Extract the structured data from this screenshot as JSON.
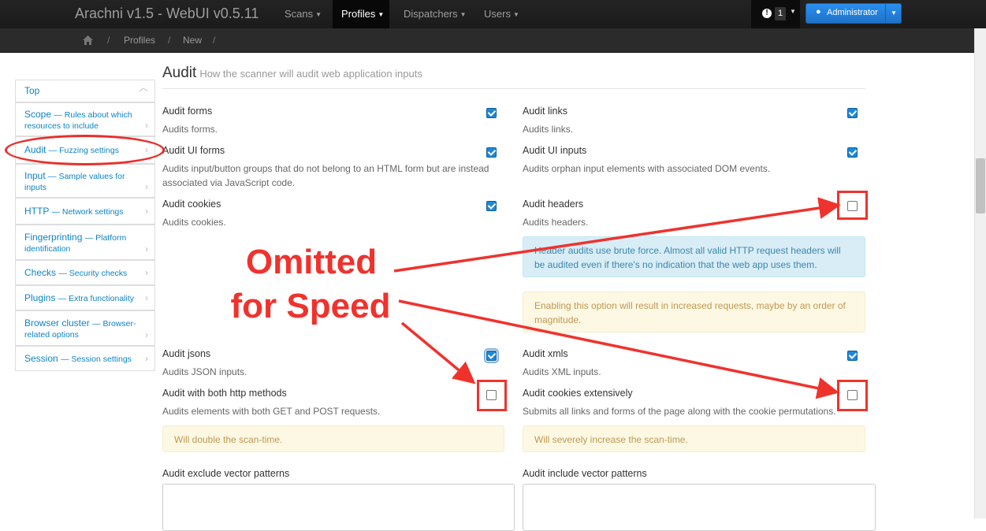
{
  "app": {
    "brand": "Arachni v1.5 - WebUI v0.5.11",
    "nav": [
      {
        "label": "Scans"
      },
      {
        "label": "Profiles"
      },
      {
        "label": "Dispatchers"
      },
      {
        "label": "Users"
      }
    ],
    "notification_count": "1",
    "user_label": "Administrator"
  },
  "breadcrumb": {
    "home_icon": "home-icon",
    "items": [
      "Profiles",
      "New"
    ],
    "separator": "/"
  },
  "sidebar": {
    "items": [
      {
        "label": "Top",
        "desc": ""
      },
      {
        "label": "Scope",
        "desc": "— Rules about which resources to include"
      },
      {
        "label": "Audit",
        "desc": "— Fuzzing settings"
      },
      {
        "label": "Input",
        "desc": "— Sample values for inputs"
      },
      {
        "label": "HTTP",
        "desc": "— Network settings"
      },
      {
        "label": "Fingerprinting",
        "desc": "— Platform identification"
      },
      {
        "label": "Checks",
        "desc": "— Security checks"
      },
      {
        "label": "Plugins",
        "desc": "— Extra functionality"
      },
      {
        "label": "Browser cluster",
        "desc": "— Browser-related options"
      },
      {
        "label": "Session",
        "desc": "— Session settings"
      }
    ]
  },
  "section": {
    "title": "Audit",
    "subtitle": "How the scanner will audit web application inputs"
  },
  "options": {
    "forms": {
      "label": "Audit forms",
      "desc": "Audits forms.",
      "checked": true
    },
    "links": {
      "label": "Audit links",
      "desc": "Audits links.",
      "checked": true
    },
    "ui_forms": {
      "label": "Audit UI forms",
      "desc": "Audits input/button groups that do not belong to an HTML form but are instead associated via JavaScript code.",
      "checked": true
    },
    "ui_inputs": {
      "label": "Audit UI inputs",
      "desc": "Audits orphan input elements with associated DOM events.",
      "checked": true
    },
    "cookies": {
      "label": "Audit cookies",
      "desc": "Audits cookies.",
      "checked": true
    },
    "headers": {
      "label": "Audit headers",
      "desc": "Audits headers.",
      "checked": false,
      "info": "Header audits use brute force. Almost all valid HTTP request headers will be audited even if there's no indication that the web app uses them.",
      "warning": "Enabling this option will result in increased requests, maybe by an order of magnitude."
    },
    "jsons": {
      "label": "Audit jsons",
      "desc": "Audits JSON inputs.",
      "checked": true
    },
    "xmls": {
      "label": "Audit xmls",
      "desc": "Audits XML inputs.",
      "checked": true
    },
    "both_methods": {
      "label": "Audit with both http methods",
      "desc": "Audits elements with both GET and POST requests.",
      "checked": false,
      "warning": "Will double the scan-time."
    },
    "cookies_extensively": {
      "label": "Audit cookies extensively",
      "desc": "Submits all links and forms of the page along with the cookie permutations.",
      "checked": false,
      "warning": "Will severely increase the scan-time."
    }
  },
  "fields": {
    "exclude_vectors": {
      "label": "Audit exclude vector patterns",
      "value": ""
    },
    "include_vectors": {
      "label": "Audit include vector patterns",
      "value": ""
    }
  },
  "annotation": {
    "line1": "Omitted",
    "line2": "for Speed"
  },
  "colors": {
    "annotation_red": "#f0322d",
    "link_blue": "#0d84c7",
    "checkbox_blue": "#1e88d6",
    "navbar": "#1b1b1b"
  }
}
